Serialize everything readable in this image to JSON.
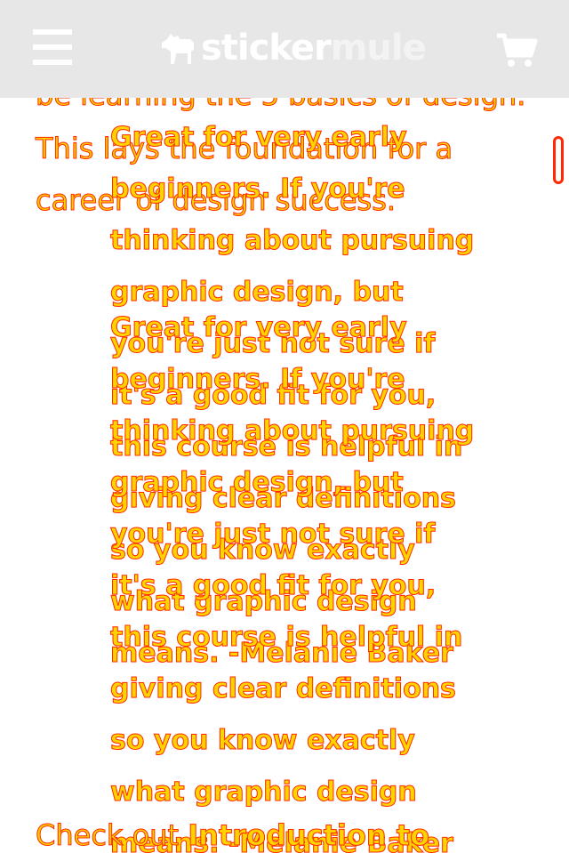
{
  "header": {
    "logo_strong": "sticker",
    "logo_light": "mule",
    "menu_icon": "hamburger-menu-icon",
    "cart_icon": "shopping-cart-icon",
    "background": "#e7e7e7"
  },
  "content": {
    "paragraph_lines": [
      "be learning the 5 basics of design.",
      "This lays the foundation for a",
      "career of design success."
    ],
    "quote": "Great for very early beginners. If you're thinking about pursuing graphic design, but you're just not sure if it's a good fit for you, this course is helpful in giving clear definitions so you know exactly what graphic design means. -Melanie Baker",
    "checkout_prefix": "Check out ",
    "checkout_link": "Introduction to"
  },
  "colors": {
    "text_fill": "#ffd200",
    "text_stroke": "#ff2a00"
  }
}
